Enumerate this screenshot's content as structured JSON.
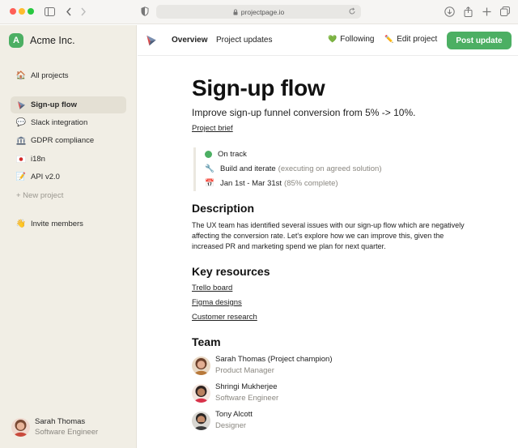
{
  "browser": {
    "url": "projectpage.io"
  },
  "sidebar": {
    "workspace_initial": "A",
    "workspace_name": "Acme Inc.",
    "items": [
      {
        "label": "All projects",
        "icon": "house-icon"
      },
      {
        "label": "Sign-up flow",
        "icon": "paper-plane-icon",
        "active": true
      },
      {
        "label": "Slack integration",
        "icon": "speech-bubble-icon"
      },
      {
        "label": "GDPR compliance",
        "icon": "bank-icon"
      },
      {
        "label": "i18n",
        "icon": "japan-flag-icon"
      },
      {
        "label": "API v2.0",
        "icon": "memo-icon"
      }
    ],
    "new_project": "+ New project",
    "invite": "Invite members",
    "user": {
      "name": "Sarah Thomas",
      "role": "Software Engineer"
    }
  },
  "topbar": {
    "tabs": [
      "Overview",
      "Project updates"
    ],
    "following": "Following",
    "edit": "Edit project",
    "post": "Post update"
  },
  "project": {
    "title": "Sign-up flow",
    "subtitle": "Improve sign-up funnel conversion from 5% -> 10%.",
    "brief": "Project brief",
    "status": "On track",
    "phase": "Build and iterate",
    "phase_note": "(executing on agreed solution)",
    "dates": "Jan 1st - Mar 31st",
    "progress_note": "(85% complete)",
    "progress_percent": 85,
    "description_heading": "Description",
    "description": "The UX team has identified several issues with our sign-up flow which are negatively affecting the conversion rate. Let's explore how we can improve this, given the increased PR and marketing spend we plan for next quarter.",
    "resources_heading": "Key resources",
    "resources": [
      "Trello board",
      "Figma designs",
      "Customer research"
    ],
    "team_heading": "Team",
    "team": [
      {
        "name": "Sarah Thomas (Project champion)",
        "role": "Product Manager"
      },
      {
        "name": "Shringi Mukherjee",
        "role": "Software Engineer"
      },
      {
        "name": "Tony Alcott",
        "role": "Designer"
      }
    ]
  },
  "colors": {
    "accent": "#4caf63",
    "sidebar_bg": "#f1eee5",
    "active_item_bg": "#e4e0d4"
  }
}
